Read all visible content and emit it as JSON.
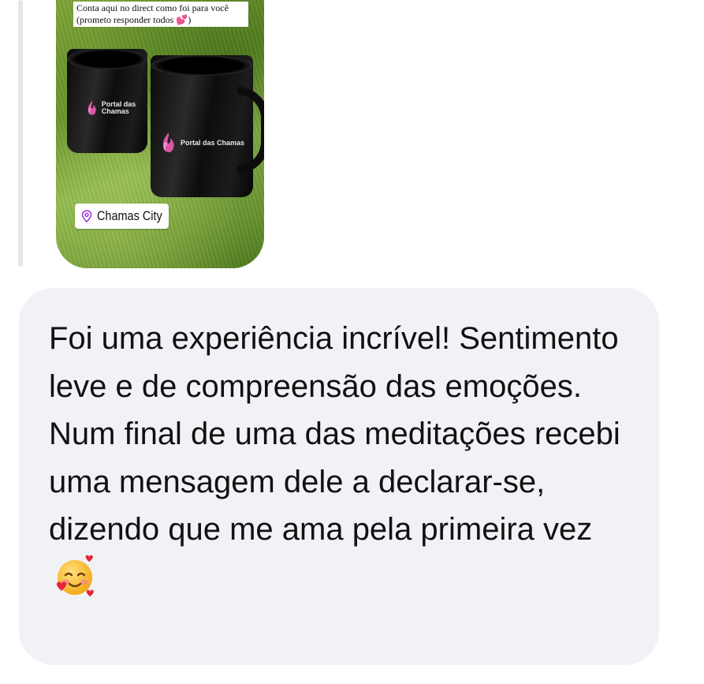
{
  "story_reply": {
    "caption": "Conta aqui no direct como foi para você (prometo responder todos 💕)",
    "mug_logo_text": "Portal das Chamas",
    "location_sticker": "Chamas City",
    "location_icon": "map-pin-icon",
    "accent_color": "#9b3bd6"
  },
  "message": {
    "text": "Foi uma experiência incrível! Sentimento leve e de compreensão das emoções. Num final de uma das meditações recebi uma mensagem dele a declarar-se, dizendo que me ama pela primeira vez",
    "emoji": "🥰",
    "emoji_icon": "smiling-face-with-hearts-icon",
    "bubble_color": "#f1f2f6"
  }
}
